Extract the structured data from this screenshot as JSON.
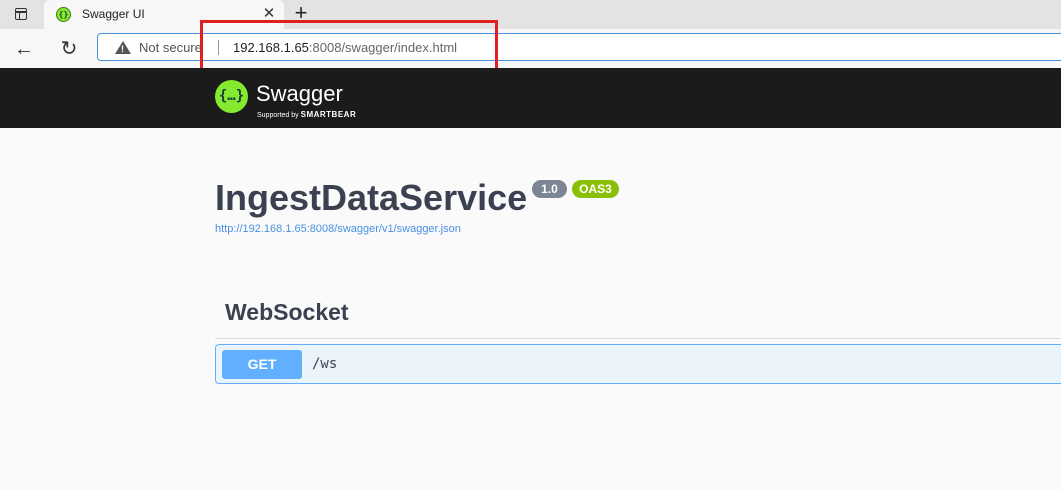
{
  "browser": {
    "tab": {
      "title": "Swagger UI",
      "favicon_glyph": "{}",
      "close_glyph": "✕"
    },
    "new_tab_glyph": "+",
    "toolbar": {
      "back_glyph": "←",
      "reload_glyph": "↻",
      "security_text": "Not secure",
      "url_host": "192.168.1.65",
      "url_rest": ":8008/swagger/index.html"
    },
    "highlight_color": "#e02020"
  },
  "topbar": {
    "logo_glyph": "{…}",
    "brand": "Swagger",
    "tagline_prefix": "Supported by",
    "tagline_brand": "SMARTBEAR"
  },
  "info": {
    "title": "IngestDataService",
    "version": "1.0",
    "oas_badge": "OAS3",
    "spec_url": "http://192.168.1.65:8008/swagger/v1/swagger.json"
  },
  "operations": {
    "tag": "WebSocket",
    "items": [
      {
        "method": "GET",
        "path": "/ws"
      }
    ]
  },
  "colors": {
    "get_method": "#61affe",
    "swagger_green": "#85ea2d",
    "topbar_bg": "#1b1b1b"
  }
}
